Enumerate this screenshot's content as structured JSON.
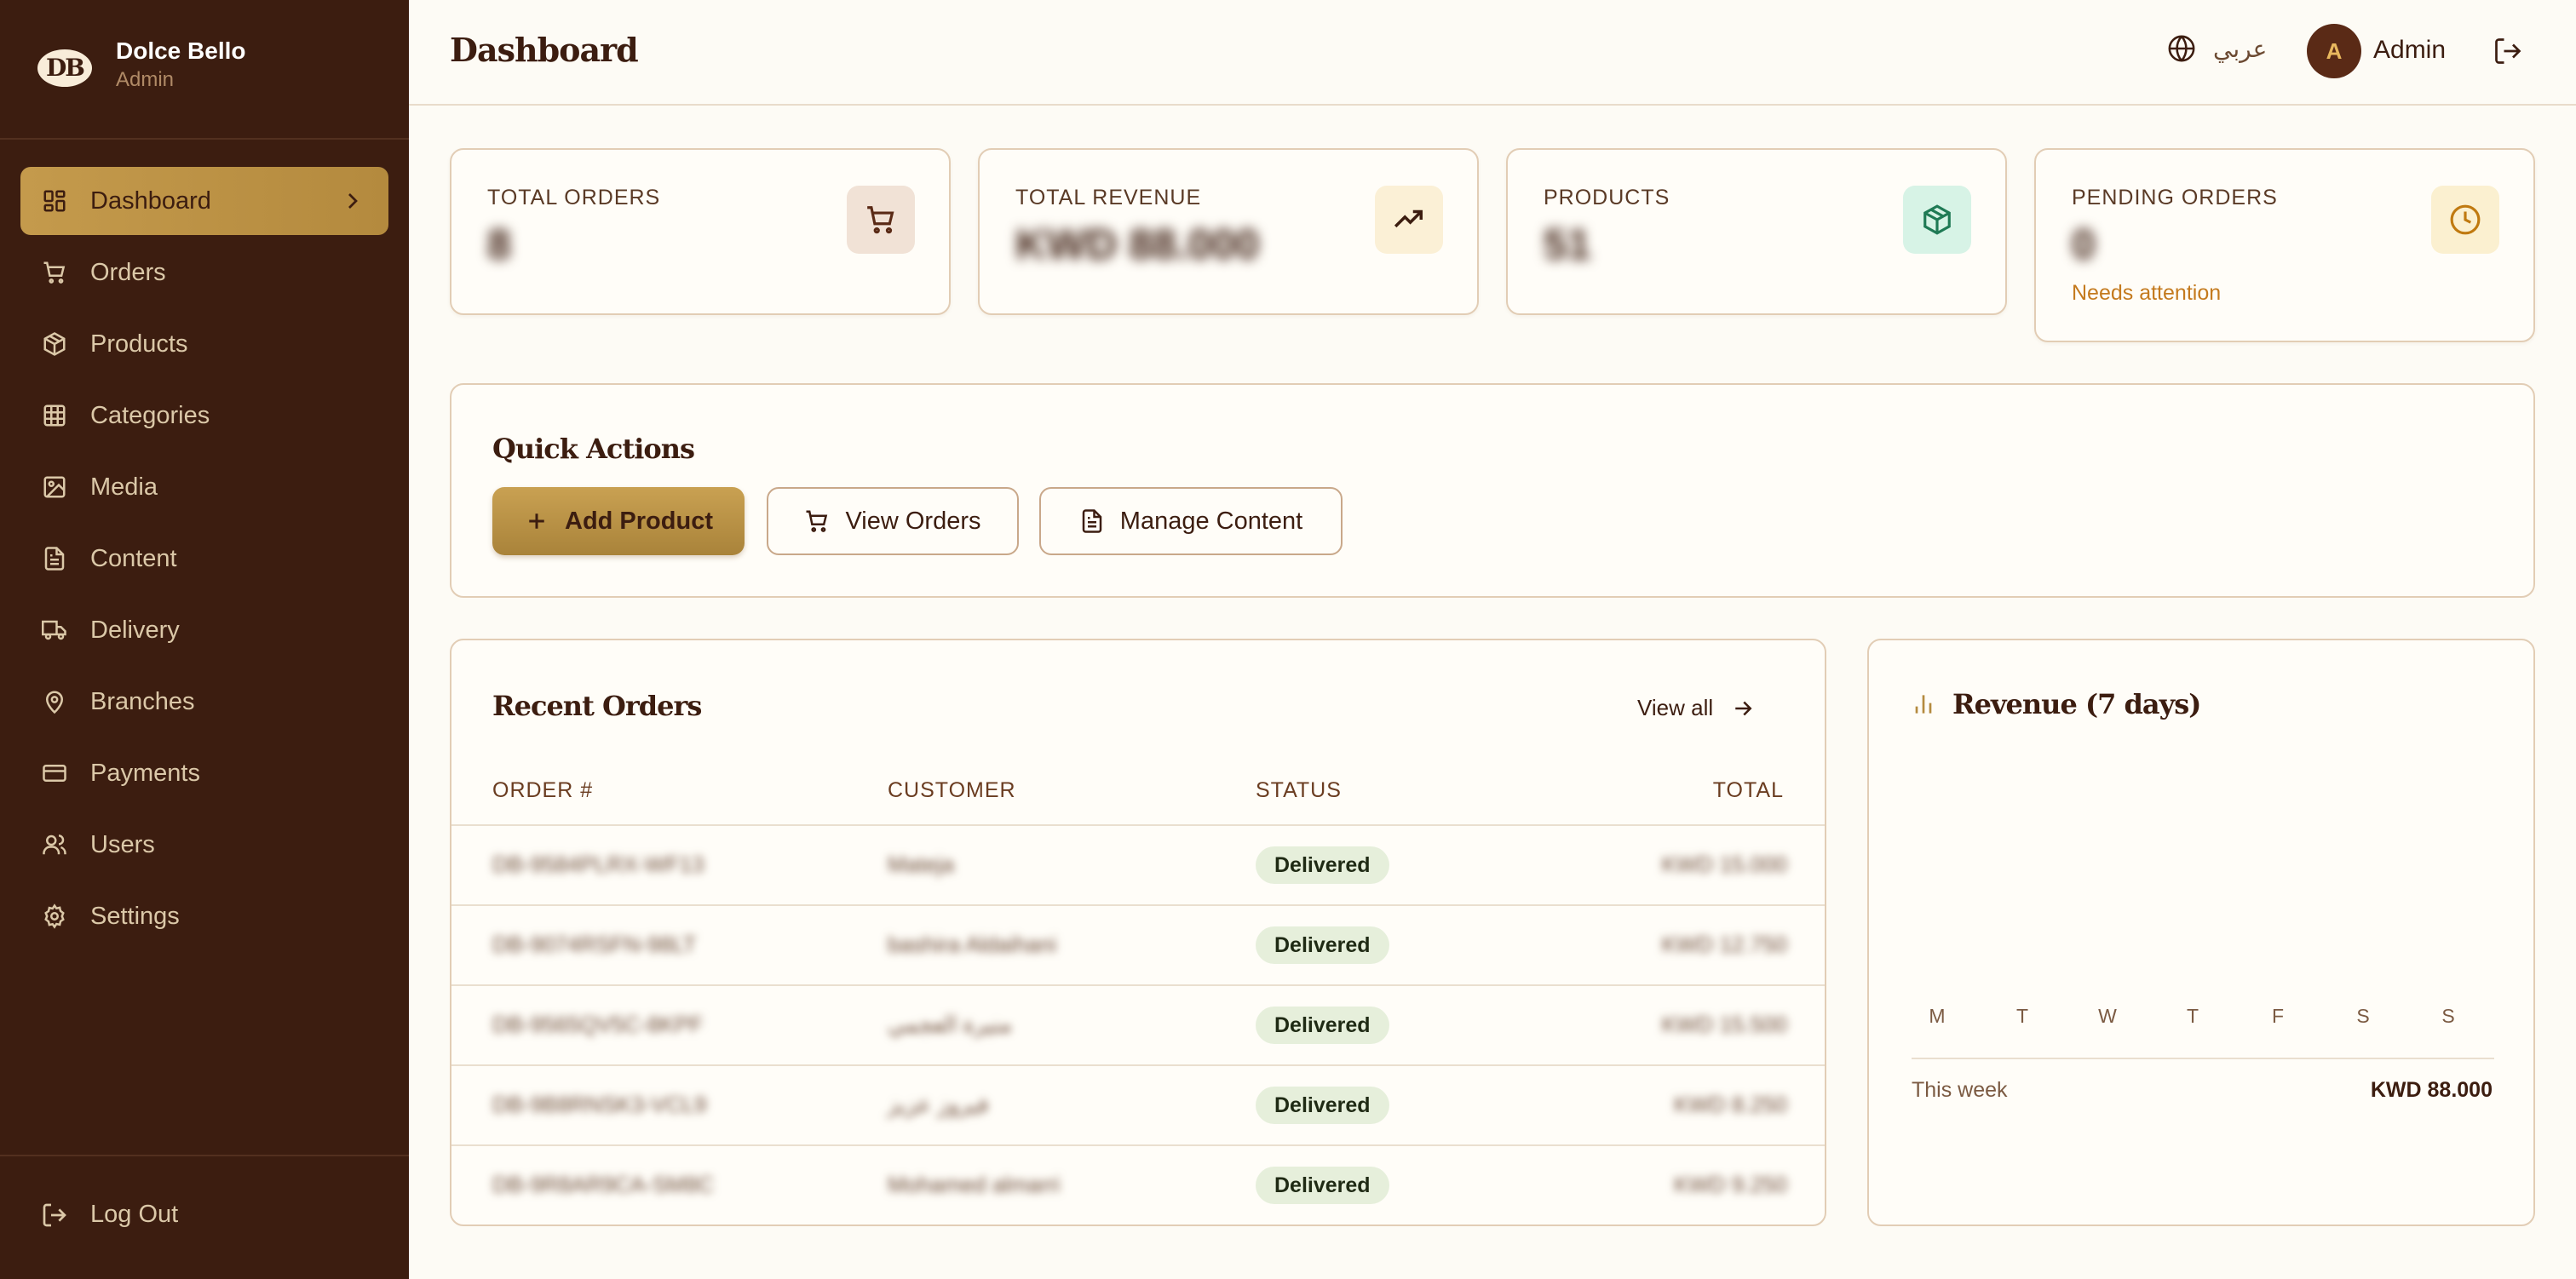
{
  "brand": {
    "logo_text": "DB",
    "name": "Dolce Bello",
    "role": "Admin"
  },
  "sidebar": {
    "items": [
      {
        "label": "Dashboard",
        "icon": "dashboard-icon",
        "active": true
      },
      {
        "label": "Orders",
        "icon": "cart-icon"
      },
      {
        "label": "Products",
        "icon": "package-icon"
      },
      {
        "label": "Categories",
        "icon": "grid-icon"
      },
      {
        "label": "Media",
        "icon": "image-icon"
      },
      {
        "label": "Content",
        "icon": "document-icon"
      },
      {
        "label": "Delivery",
        "icon": "truck-icon"
      },
      {
        "label": "Branches",
        "icon": "map-pin-icon"
      },
      {
        "label": "Payments",
        "icon": "credit-card-icon"
      },
      {
        "label": "Users",
        "icon": "users-icon"
      },
      {
        "label": "Settings",
        "icon": "gear-icon"
      }
    ],
    "logout_label": "Log Out"
  },
  "header": {
    "title": "Dashboard",
    "language_label": "عربي",
    "avatar_initial": "A",
    "user_name": "Admin"
  },
  "stats": [
    {
      "label": "TOTAL ORDERS",
      "value": "8",
      "icon": "cart-icon",
      "icon_bg": "#f1e2d6",
      "icon_color": "#5a2a16"
    },
    {
      "label": "TOTAL REVENUE",
      "value": "KWD 88.000",
      "icon": "trending-up-icon",
      "icon_bg": "#fbf0d6",
      "icon_color": "#3c1d10"
    },
    {
      "label": "PRODUCTS",
      "value": "51",
      "icon": "package-icon",
      "icon_bg": "#d7f3e6",
      "icon_color": "#1f7a55"
    },
    {
      "label": "PENDING ORDERS",
      "value": "0",
      "note": "Needs attention",
      "icon": "clock-icon",
      "icon_bg": "#fbf0d0",
      "icon_color": "#c07a10"
    }
  ],
  "quick_actions": {
    "title": "Quick Actions",
    "add_product": "Add Product",
    "view_orders": "View Orders",
    "manage_content": "Manage Content"
  },
  "recent_orders": {
    "title": "Recent Orders",
    "view_all": "View all",
    "columns": [
      "ORDER #",
      "CUSTOMER",
      "STATUS",
      "TOTAL"
    ],
    "rows": [
      {
        "order": "DB-9584PLRX-WF13",
        "customer": "Mateja",
        "status": "Delivered",
        "total": "KWD 15.000"
      },
      {
        "order": "DB-9074RSFN-98LT",
        "customer": "bashira Aldaihani",
        "status": "Delivered",
        "total": "KWD 12.750"
      },
      {
        "order": "DB-9565QV5C-8KPF",
        "customer": "منيرة العجمي",
        "status": "Delivered",
        "total": "KWD 15.500"
      },
      {
        "order": "DB-9B8RNSK3-VCL9",
        "customer": "فيروز عزيز",
        "status": "Delivered",
        "total": "KWD 8.250"
      },
      {
        "order": "DB-9R8AR9CA-SM8C",
        "customer": "Mohamed almarri",
        "status": "Delivered",
        "total": "KWD 9.250"
      }
    ]
  },
  "revenue": {
    "title": "Revenue (7 days)",
    "days": [
      "M",
      "T",
      "W",
      "T",
      "F",
      "S",
      "S"
    ],
    "week_label": "This week",
    "week_total": "KWD 88.000"
  },
  "colors": {
    "sidebar_bg": "#3c1d10",
    "accent_gold": "#c49a4c",
    "page_bg": "#fdfbf5",
    "card_border": "#e2cdb5",
    "badge_bg": "#e6efdb",
    "warning_text": "#c47a1e"
  }
}
